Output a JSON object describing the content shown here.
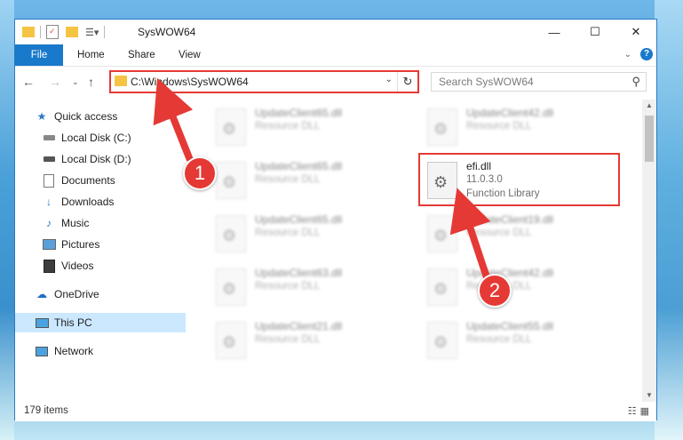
{
  "window": {
    "title": "SysWOW64",
    "controls": {
      "minimize": "—",
      "maximize": "☐",
      "close": "✕"
    }
  },
  "ribbon": {
    "tabs": [
      "File",
      "Home",
      "Share",
      "View"
    ],
    "expand_icon": "chevron-down-icon"
  },
  "nav": {
    "address": "C:\\Windows\\SysWOW64",
    "search_placeholder": "Search SysWOW64"
  },
  "sidebar": {
    "items": [
      {
        "label": "Quick access",
        "icon": "star-icon"
      },
      {
        "label": "Local Disk (C:)",
        "icon": "drive-icon",
        "pinned": true
      },
      {
        "label": "Local Disk (D:)",
        "icon": "drive-icon",
        "pinned": true
      },
      {
        "label": "Documents",
        "icon": "documents-icon",
        "pinned": true
      },
      {
        "label": "Downloads",
        "icon": "download-icon",
        "pinned": true
      },
      {
        "label": "Music",
        "icon": "music-icon",
        "pinned": true
      },
      {
        "label": "Pictures",
        "icon": "pictures-icon",
        "pinned": true
      },
      {
        "label": "Videos",
        "icon": "videos-icon",
        "pinned": true
      },
      {
        "label": "OneDrive",
        "icon": "cloud-icon"
      },
      {
        "label": "This PC",
        "icon": "computer-icon",
        "selected": true
      },
      {
        "label": "Network",
        "icon": "network-icon"
      }
    ]
  },
  "files": [
    {
      "name": "UpdateClient65.dll",
      "type": "Resource DLL"
    },
    {
      "name": "UpdateClient42.dll",
      "type": "Resource DLL"
    },
    {
      "name": "UpdateClient65.dll",
      "type": "Resource DLL"
    },
    {
      "name": "efi.dll",
      "version": "11.0.3.0",
      "type": "Function Library"
    },
    {
      "name": "UpdateClient65.dll",
      "type": "Resource DLL"
    },
    {
      "name": "UpdateClient19.dll",
      "type": "Resource DLL"
    },
    {
      "name": "UpdateClient63.dll",
      "type": "Resource DLL"
    },
    {
      "name": "UpdateClient42.dll",
      "type": "Resource DLL"
    },
    {
      "name": "UpdateClient21.dll",
      "type": "Resource DLL"
    },
    {
      "name": "UpdateClient55.dll",
      "type": "Resource DLL"
    }
  ],
  "status": {
    "item_count": "179 items"
  },
  "annotations": {
    "step1": "1",
    "step2": "2",
    "color": "#e53935"
  }
}
